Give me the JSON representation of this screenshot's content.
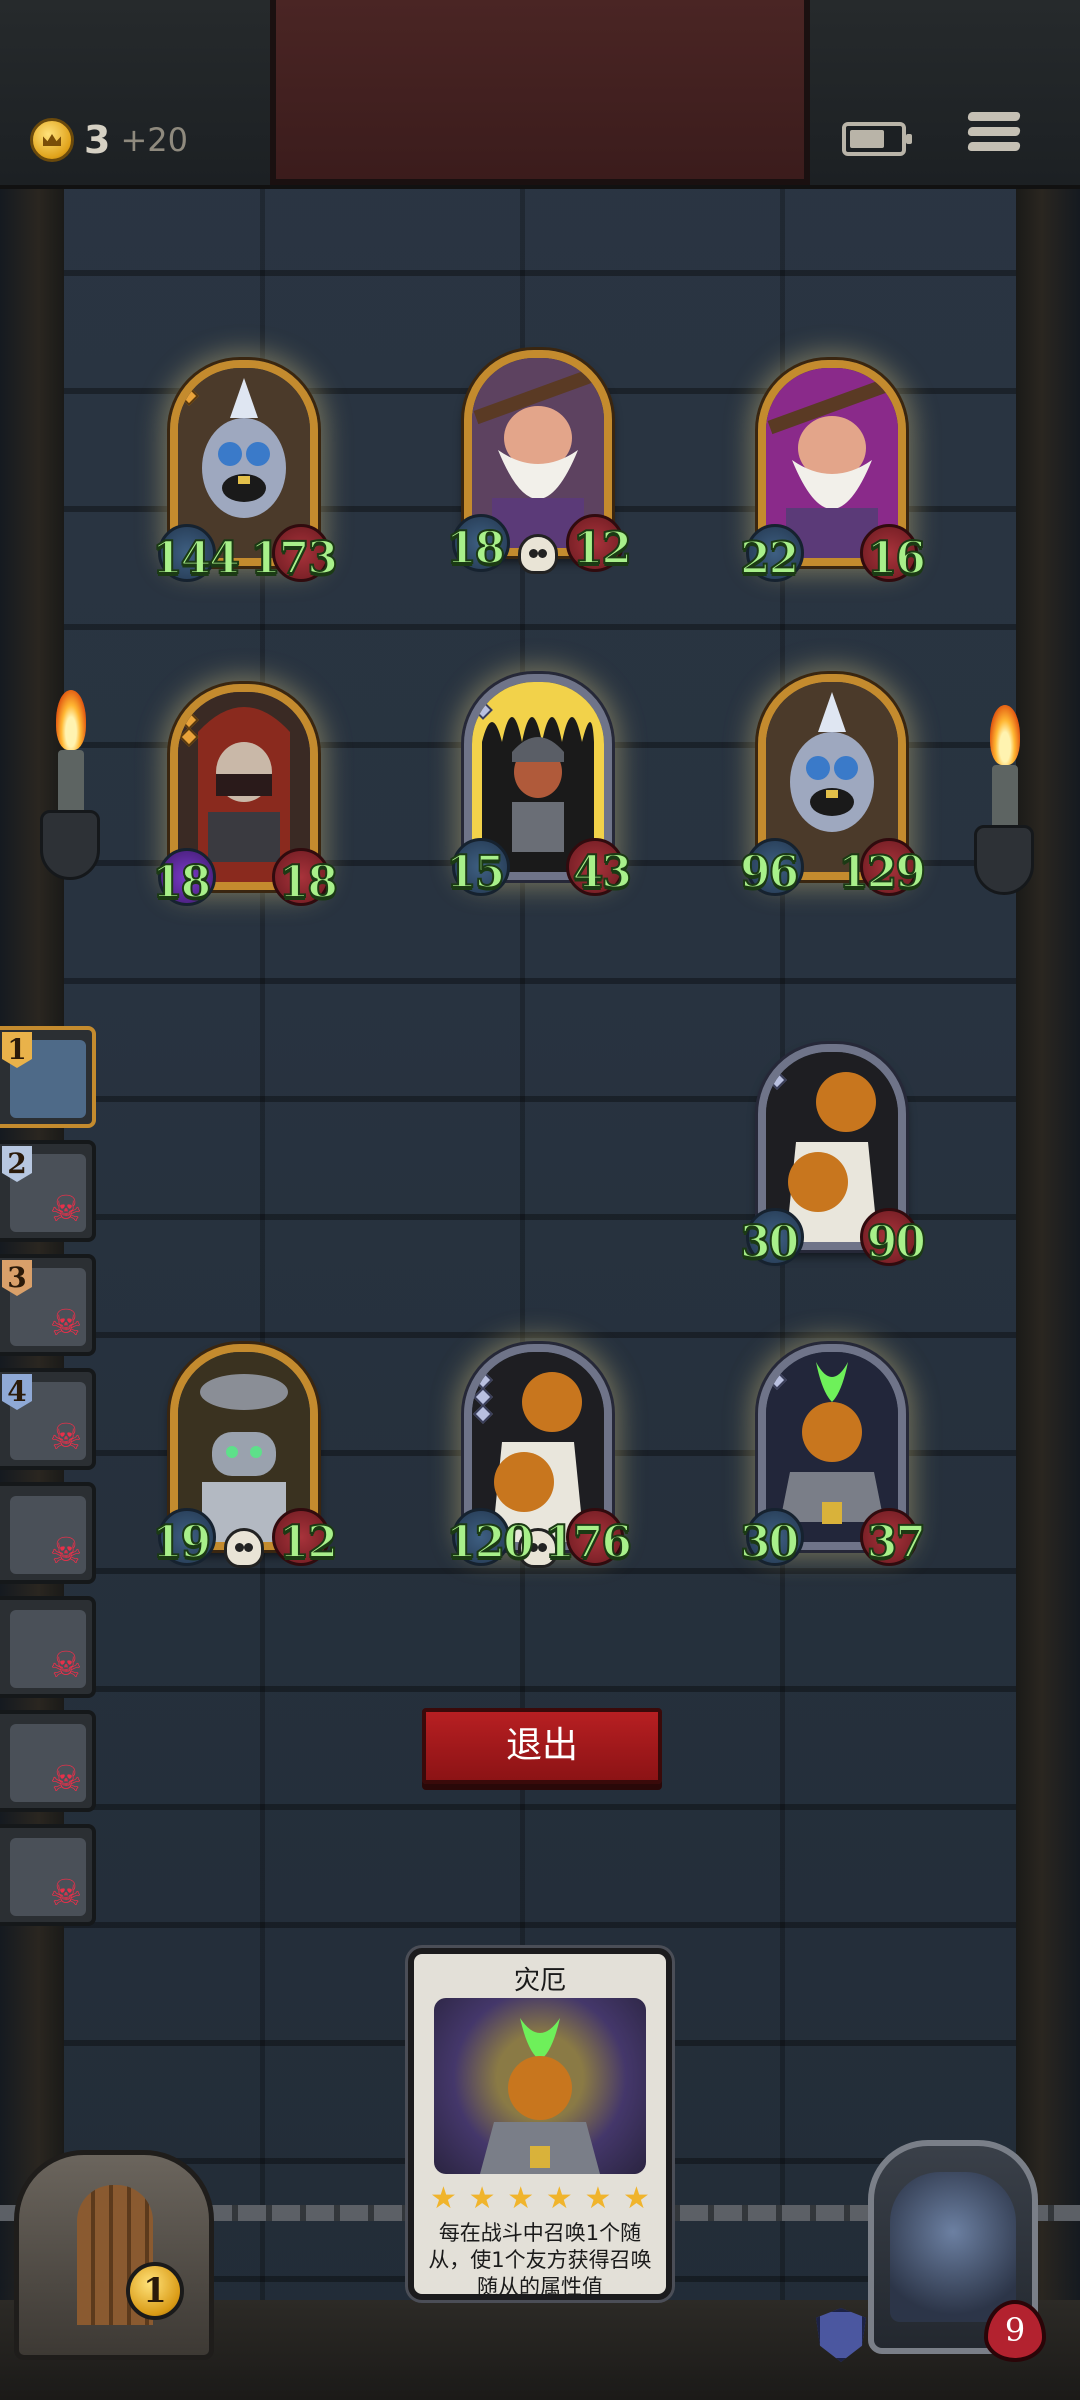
{
  "hud": {
    "gold": "3",
    "gold_income": "+20"
  },
  "enemy_board": [
    {
      "atk": "144",
      "hp": "173",
      "frame": "gold"
    },
    {
      "atk": "18",
      "hp": "12",
      "frame": "gold"
    },
    {
      "atk": "22",
      "hp": "16",
      "frame": "gold"
    },
    {
      "atk": "18",
      "hp": "18",
      "frame": "gold"
    },
    {
      "atk": "15",
      "hp": "43",
      "frame": "silver"
    },
    {
      "atk": "96",
      "hp": "129",
      "frame": "gold"
    }
  ],
  "player_board": [
    {
      "atk": "30",
      "hp": "90",
      "frame": "silver"
    },
    {
      "atk": "19",
      "hp": "12",
      "frame": "gold"
    },
    {
      "atk": "120",
      "hp": "176",
      "frame": "silver"
    },
    {
      "atk": "30",
      "hp": "37",
      "frame": "silver"
    }
  ],
  "opponents": [
    {
      "rank": "1",
      "status": "active"
    },
    {
      "rank": "2",
      "status": "eliminated"
    },
    {
      "rank": "3",
      "status": "eliminated"
    },
    {
      "rank": "4",
      "status": "eliminated"
    },
    {
      "rank": "",
      "status": "eliminated"
    },
    {
      "rank": "",
      "status": "eliminated"
    },
    {
      "rank": "",
      "status": "eliminated"
    },
    {
      "rank": "",
      "status": "eliminated"
    }
  ],
  "exit_button": {
    "label": "退出"
  },
  "spell_card": {
    "title": "灾厄",
    "stars": 6,
    "description": "每在战斗中召唤1个随从，使1个友方获得召唤随从的属性值"
  },
  "player": {
    "level": "1",
    "health": "9"
  },
  "colors": {
    "gold_frame": "#c48b2e",
    "silver_frame": "#6f7489",
    "exit_red": "#b71f22",
    "stat_green": "#a8f08a"
  }
}
